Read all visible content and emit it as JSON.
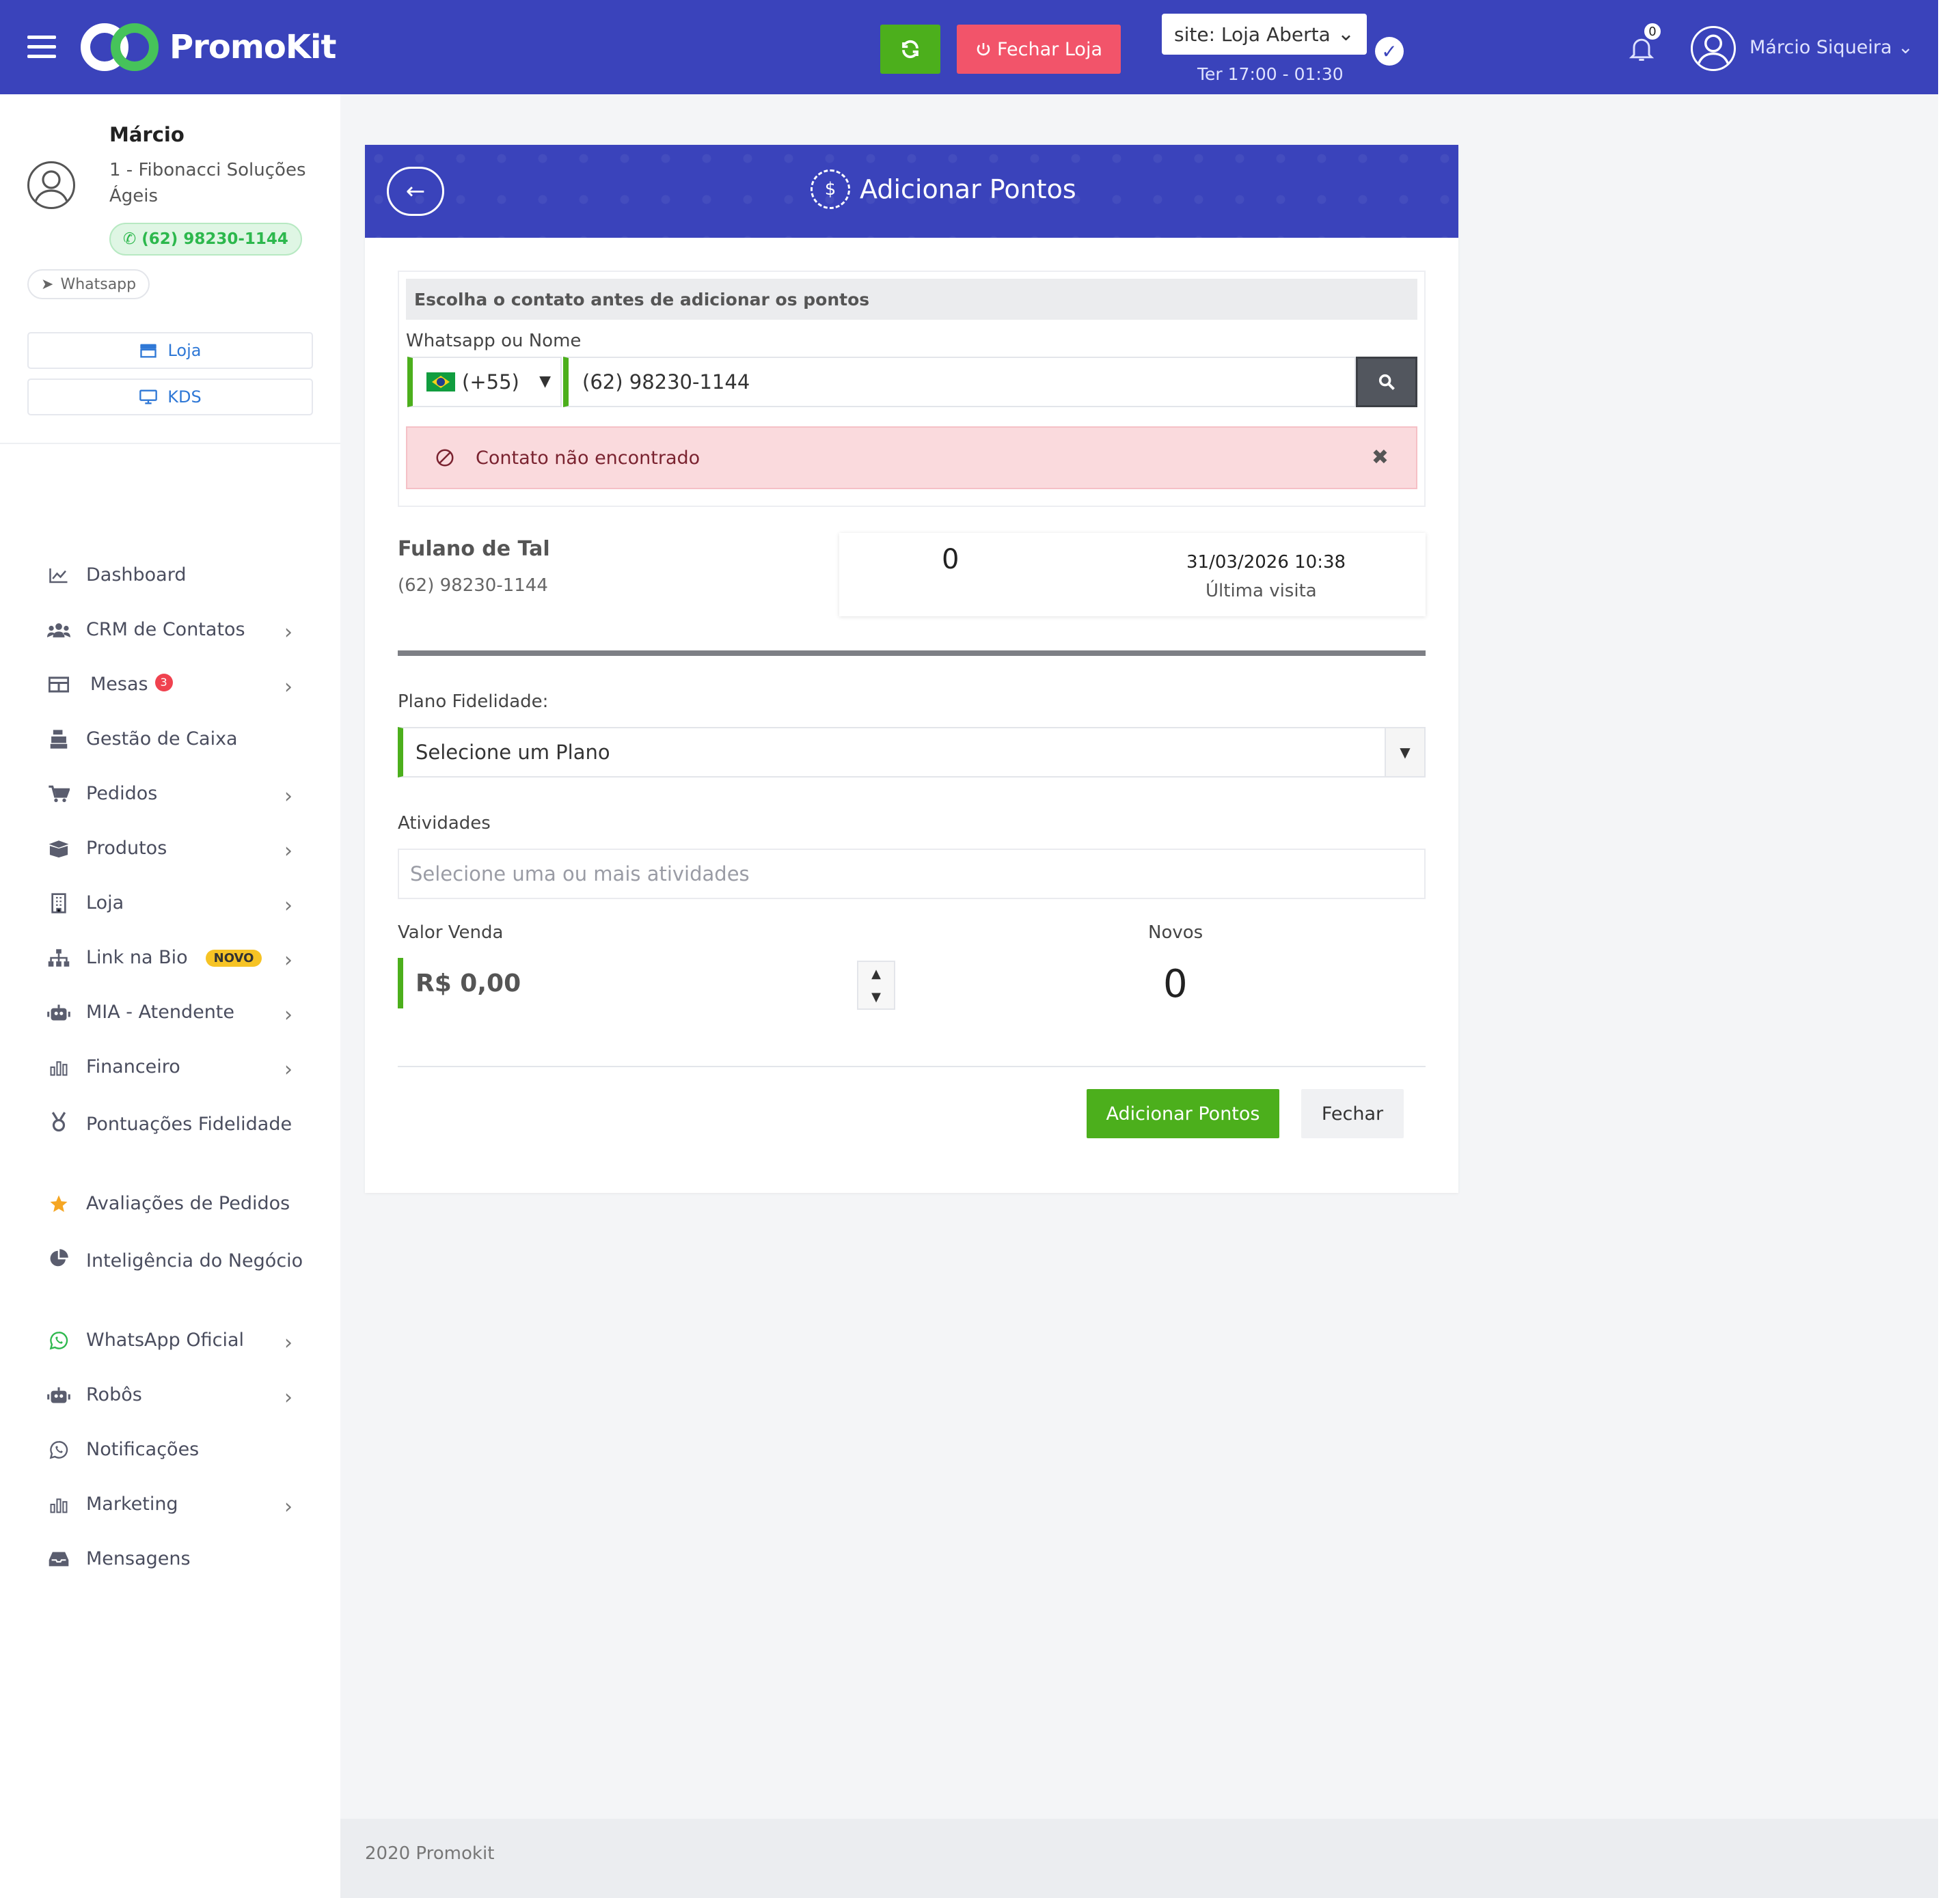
{
  "topbar": {
    "brand": "PromoKit",
    "fechar_loja_label": "Fechar Loja",
    "store_status": "site: Loja Aberta",
    "store_hours": "Ter 17:00 - 01:30",
    "notification_count": "0",
    "user_name": "Márcio Siqueira",
    "colors": {
      "bar": "#3a43bb",
      "refresh": "#4caf1c",
      "close_store": "#f2546a"
    }
  },
  "profile": {
    "name": "Márcio",
    "company": "1 - Fibonacci Soluções Ágeis",
    "phone": "(62) 98230-1144",
    "whatsapp_label": "Whatsapp"
  },
  "sidebar": {
    "buttons": [
      {
        "label": "Loja",
        "icon": "store-icon"
      },
      {
        "label": "KDS",
        "icon": "monitor-icon"
      }
    ],
    "items": [
      {
        "label": "Dashboard",
        "icon": "chart-line-icon",
        "chevron": false
      },
      {
        "label": "CRM de Contatos",
        "icon": "users-icon",
        "chevron": true
      },
      {
        "label": "Mesas",
        "icon": "table-icon",
        "chevron": true,
        "badge": "3"
      },
      {
        "label": "Gestão de Caixa",
        "icon": "cash-register-icon",
        "chevron": false
      },
      {
        "label": "Pedidos",
        "icon": "cart-icon",
        "chevron": true
      },
      {
        "label": "Produtos",
        "icon": "box-icon",
        "chevron": true
      },
      {
        "label": "Loja",
        "icon": "building-icon",
        "chevron": true
      },
      {
        "label": "Link na Bio",
        "icon": "sitemap-icon",
        "chevron": true,
        "tag": "NOVO"
      },
      {
        "label": "MIA - Atendente",
        "icon": "robot-icon",
        "chevron": true
      },
      {
        "label": "Financeiro",
        "icon": "bar-chart-icon",
        "chevron": true
      },
      {
        "label": "Pontuações Fidelidade",
        "icon": "medal-icon",
        "chevron": false
      },
      {
        "label": "Avaliações de Pedidos",
        "icon": "star-icon",
        "chevron": false
      },
      {
        "label": "Inteligência do Negócio",
        "icon": "pie-chart-icon",
        "chevron": false
      },
      {
        "label": "WhatsApp Oficial",
        "icon": "whatsapp-icon",
        "chevron": true
      },
      {
        "label": "Robôs",
        "icon": "robot-icon",
        "chevron": true
      },
      {
        "label": "Notificações",
        "icon": "whatsapp-icon",
        "chevron": false
      },
      {
        "label": "Marketing",
        "icon": "bar-chart-icon",
        "chevron": true
      },
      {
        "label": "Mensagens",
        "icon": "inbox-icon",
        "chevron": false
      }
    ]
  },
  "card": {
    "title": "Adicionar Pontos",
    "contact_section_title": "Escolha o contato antes de adicionar os pontos",
    "contact_field_label": "Whatsapp ou Nome",
    "country_code": "(+55)",
    "phone_value": "(62) 98230-1144",
    "alert_text": "Contato não encontrado",
    "customer_name": "Fulano de Tal",
    "customer_phone": "(62) 98230-1144",
    "points": "0",
    "last_visit_date": "31/03/2026 10:38",
    "last_visit_label": "Última visita",
    "plan_label": "Plano Fidelidade:",
    "plan_value": "Selecione um Plano",
    "activities_label": "Atividades",
    "activities_placeholder": "Selecione uma ou mais atividades",
    "sale_label": "Valor Venda",
    "sale_value": "R$ 0,00",
    "new_points_label": "Novos",
    "new_points_value": "0",
    "submit_label": "Adicionar Pontos",
    "close_label": "Fechar"
  },
  "footer": {
    "text": "2020 Promokit"
  }
}
